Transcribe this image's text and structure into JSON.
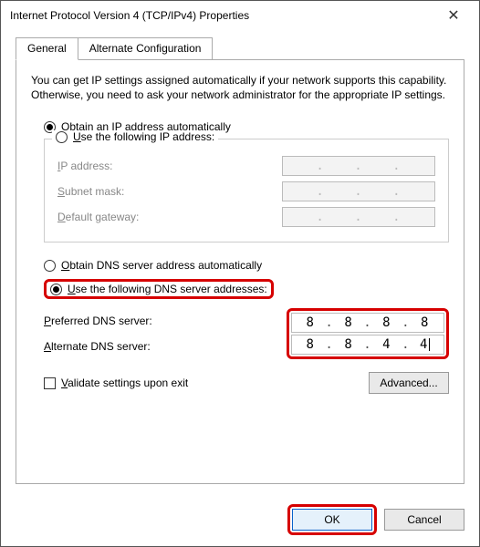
{
  "window": {
    "title": "Internet Protocol Version 4 (TCP/IPv4) Properties"
  },
  "tabs": {
    "general": "General",
    "alt": "Alternate Configuration"
  },
  "description": "You can get IP settings assigned automatically if your network supports this capability. Otherwise, you need to ask your network administrator for the appropriate IP settings.",
  "ip": {
    "auto_label_pre": "O",
    "auto_label_rest": "btain an IP address automatically",
    "manual_label_pre": "U",
    "manual_label_rest": "se the following IP address:",
    "ip_label_pre": "I",
    "ip_label_rest": "P address:",
    "subnet_label_pre": "S",
    "subnet_label_rest": "ubnet mask:",
    "gw_label_pre": "D",
    "gw_label_rest": "efault gateway:"
  },
  "dns": {
    "auto_label_pre": "O",
    "auto_label_rest": "btain DNS server address automatically",
    "manual_label_pre": "U",
    "manual_label_rest": "se the following DNS server addresses:",
    "pref_label_pre": "P",
    "pref_label_rest": "referred DNS server:",
    "alt_label_pre": "A",
    "alt_label_rest": "lternate DNS server:",
    "pref": [
      "8",
      "8",
      "8",
      "8"
    ],
    "alt": [
      "8",
      "8",
      "4",
      "4"
    ]
  },
  "validate_label_pre": "V",
  "validate_label_rest": "alidate settings upon exit",
  "advanced_label": "Advanced...",
  "ok_label": "OK",
  "cancel_label": "Cancel"
}
